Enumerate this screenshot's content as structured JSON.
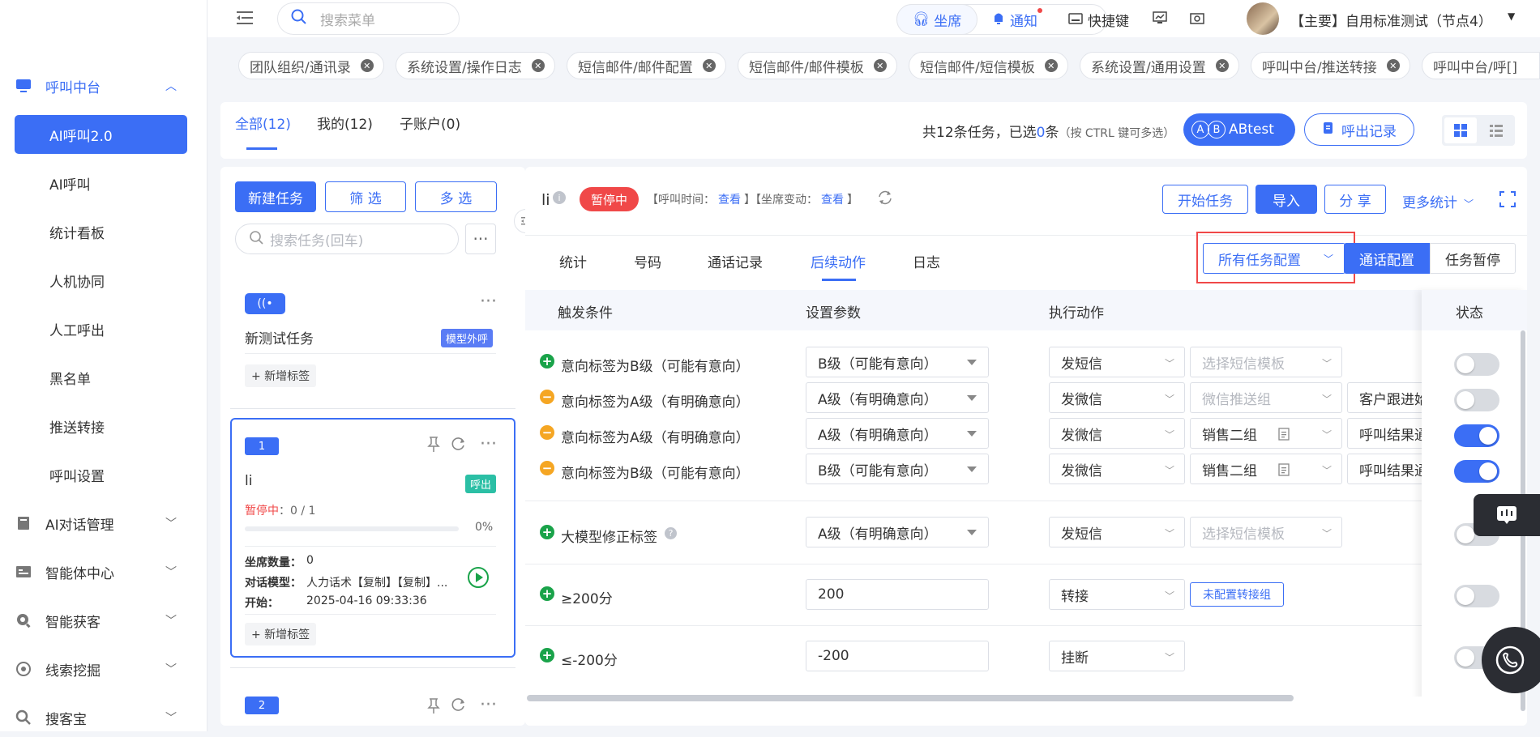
{
  "topbar": {
    "search_placeholder": "搜索菜单",
    "seat_label": "坐席",
    "notify_label": "通知",
    "shortcut_label": "快捷键",
    "account_label": "【主要】自用标准测试（节点4）"
  },
  "tabs": [
    {
      "label": "团队组织/通讯录"
    },
    {
      "label": "系统设置/操作日志"
    },
    {
      "label": "短信邮件/邮件配置"
    },
    {
      "label": "短信邮件/邮件模板"
    },
    {
      "label": "短信邮件/短信模板"
    },
    {
      "label": "系统设置/通用设置"
    },
    {
      "label": "呼叫中台/推送转接"
    },
    {
      "label": "呼叫中台/呼[]"
    }
  ],
  "sidebar": {
    "group_label": "呼叫中台",
    "sub_items": [
      {
        "label": "AI呼叫2.0"
      },
      {
        "label": "AI呼叫"
      },
      {
        "label": "统计看板"
      },
      {
        "label": "人机协同"
      },
      {
        "label": "人工呼出"
      },
      {
        "label": "黑名单"
      },
      {
        "label": "推送转接"
      },
      {
        "label": "呼叫设置"
      }
    ],
    "groups": [
      {
        "label": "AI对话管理"
      },
      {
        "label": "智能体中心"
      },
      {
        "label": "智能获客"
      },
      {
        "label": "线索挖掘"
      },
      {
        "label": "搜客宝"
      }
    ]
  },
  "header": {
    "tabs": [
      {
        "label": "全部(12)"
      },
      {
        "label": "我的(12)"
      },
      {
        "label": "子账户(0)"
      }
    ],
    "summary_prefix": "共12条任务，已选",
    "summary_count": "0",
    "summary_suffix": "条",
    "summary_hint": "（按 CTRL 键可多选）",
    "abtest_label": "ABtest",
    "abtest_a": "A",
    "abtest_b": "B",
    "call_record_label": "呼出记录"
  },
  "left": {
    "new_task": "新建任务",
    "filter": "筛 选",
    "multi": "多 选",
    "search_placeholder": "搜索任务(回车)",
    "card0": {
      "title": "新测试任务",
      "badge": "模型外呼",
      "add_tag": "+ 新增标签"
    },
    "card1": {
      "num": "1",
      "title": "li",
      "badge": "呼出",
      "status": "暂停中",
      "progress": "：0 / 1",
      "percent": "0%",
      "seats_label": "坐席数量：",
      "seats_value": "0",
      "model_label": "对话模型：",
      "model_value": "人力话术【复制】【复制】...",
      "start_label": "开始：",
      "start_value": "2025-04-16 09:33:36",
      "add_tag": "+ 新增标签"
    },
    "card2": {
      "num": "2"
    }
  },
  "detail": {
    "title": "li",
    "status_badge": "暂停中",
    "meta_open1": "【呼叫时间：",
    "meta_link1": "查看",
    "meta_mid": "】【坐席变动：",
    "meta_link2": "查看",
    "meta_close": "】",
    "start_btn": "开始任务",
    "import_btn": "导入",
    "share_btn": "分 享",
    "more_stats": "更多统计",
    "subtabs": [
      {
        "label": "统计"
      },
      {
        "label": "号码"
      },
      {
        "label": "通话记录"
      },
      {
        "label": "后续动作"
      },
      {
        "label": "日志"
      }
    ],
    "config_dropdown": "所有任务配置",
    "call_config": "通话配置",
    "task_pause": "任务暂停"
  },
  "table": {
    "headers": {
      "trigger": "触发条件",
      "params": "设置参数",
      "action": "执行动作",
      "status": "状态"
    },
    "rows": [
      {
        "cond": "意向标签为B级（可能有意向）",
        "param": "B级（可能有意向）",
        "action": "发短信",
        "a2": "选择短信模板",
        "a3": "",
        "on": false
      },
      {
        "cond": "意向标签为A级（有明确意向）",
        "param": "A级（有明确意向）",
        "action": "发微信",
        "a2": "微信推送组",
        "a3": "客户跟进始",
        "on": false
      },
      {
        "cond": "意向标签为A级（有明确意向）",
        "param": "A级（有明确意向）",
        "action": "发微信",
        "a2": "销售二组",
        "a3": "呼叫结果通",
        "on": true
      },
      {
        "cond": "意向标签为B级（可能有意向）",
        "param": "B级（可能有意向）",
        "action": "发微信",
        "a2": "销售二组",
        "a3": "呼叫结果通",
        "on": true
      },
      {
        "cond": "大模型修正标签",
        "param": "A级（有明确意向）",
        "action": "发短信",
        "a2": "选择短信模板",
        "a3": "",
        "on": false
      },
      {
        "cond": "≥200分",
        "param": "200",
        "action": "转接",
        "a2": "未配置转接组",
        "a3": "",
        "on": false
      },
      {
        "cond": "≤-200分",
        "param": "-200",
        "action": "挂断",
        "a2": "",
        "a3": "",
        "on": false
      }
    ]
  },
  "colors": {
    "accent": "#3b6ef5",
    "danger": "#f04848",
    "green": "#1aa34a",
    "orange": "#f5a623"
  }
}
